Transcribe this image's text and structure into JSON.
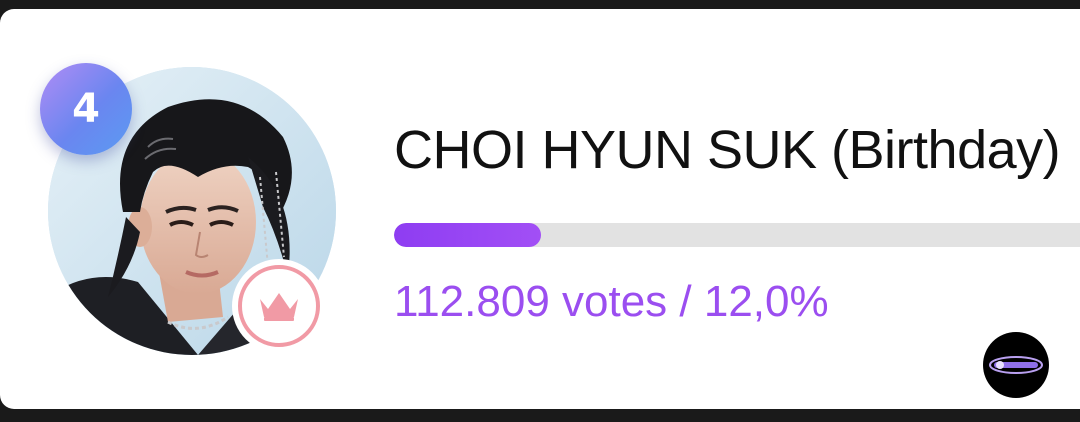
{
  "candidate": {
    "rank": "4",
    "name": "CHOI HYUN SUK (Birthday)",
    "votes_text": "112.809 votes / 12,0%",
    "vote_share_fraction": 0.12
  },
  "colors": {
    "accent_purple": "#9b4ef0",
    "progress_fill": "#8e3df2",
    "progress_track": "#e2e2e2",
    "rank_badge": "#6a86f0",
    "crown": "#f19aa5"
  },
  "icons": {
    "crown": "crown-icon",
    "watermark": "watermark-logo"
  }
}
